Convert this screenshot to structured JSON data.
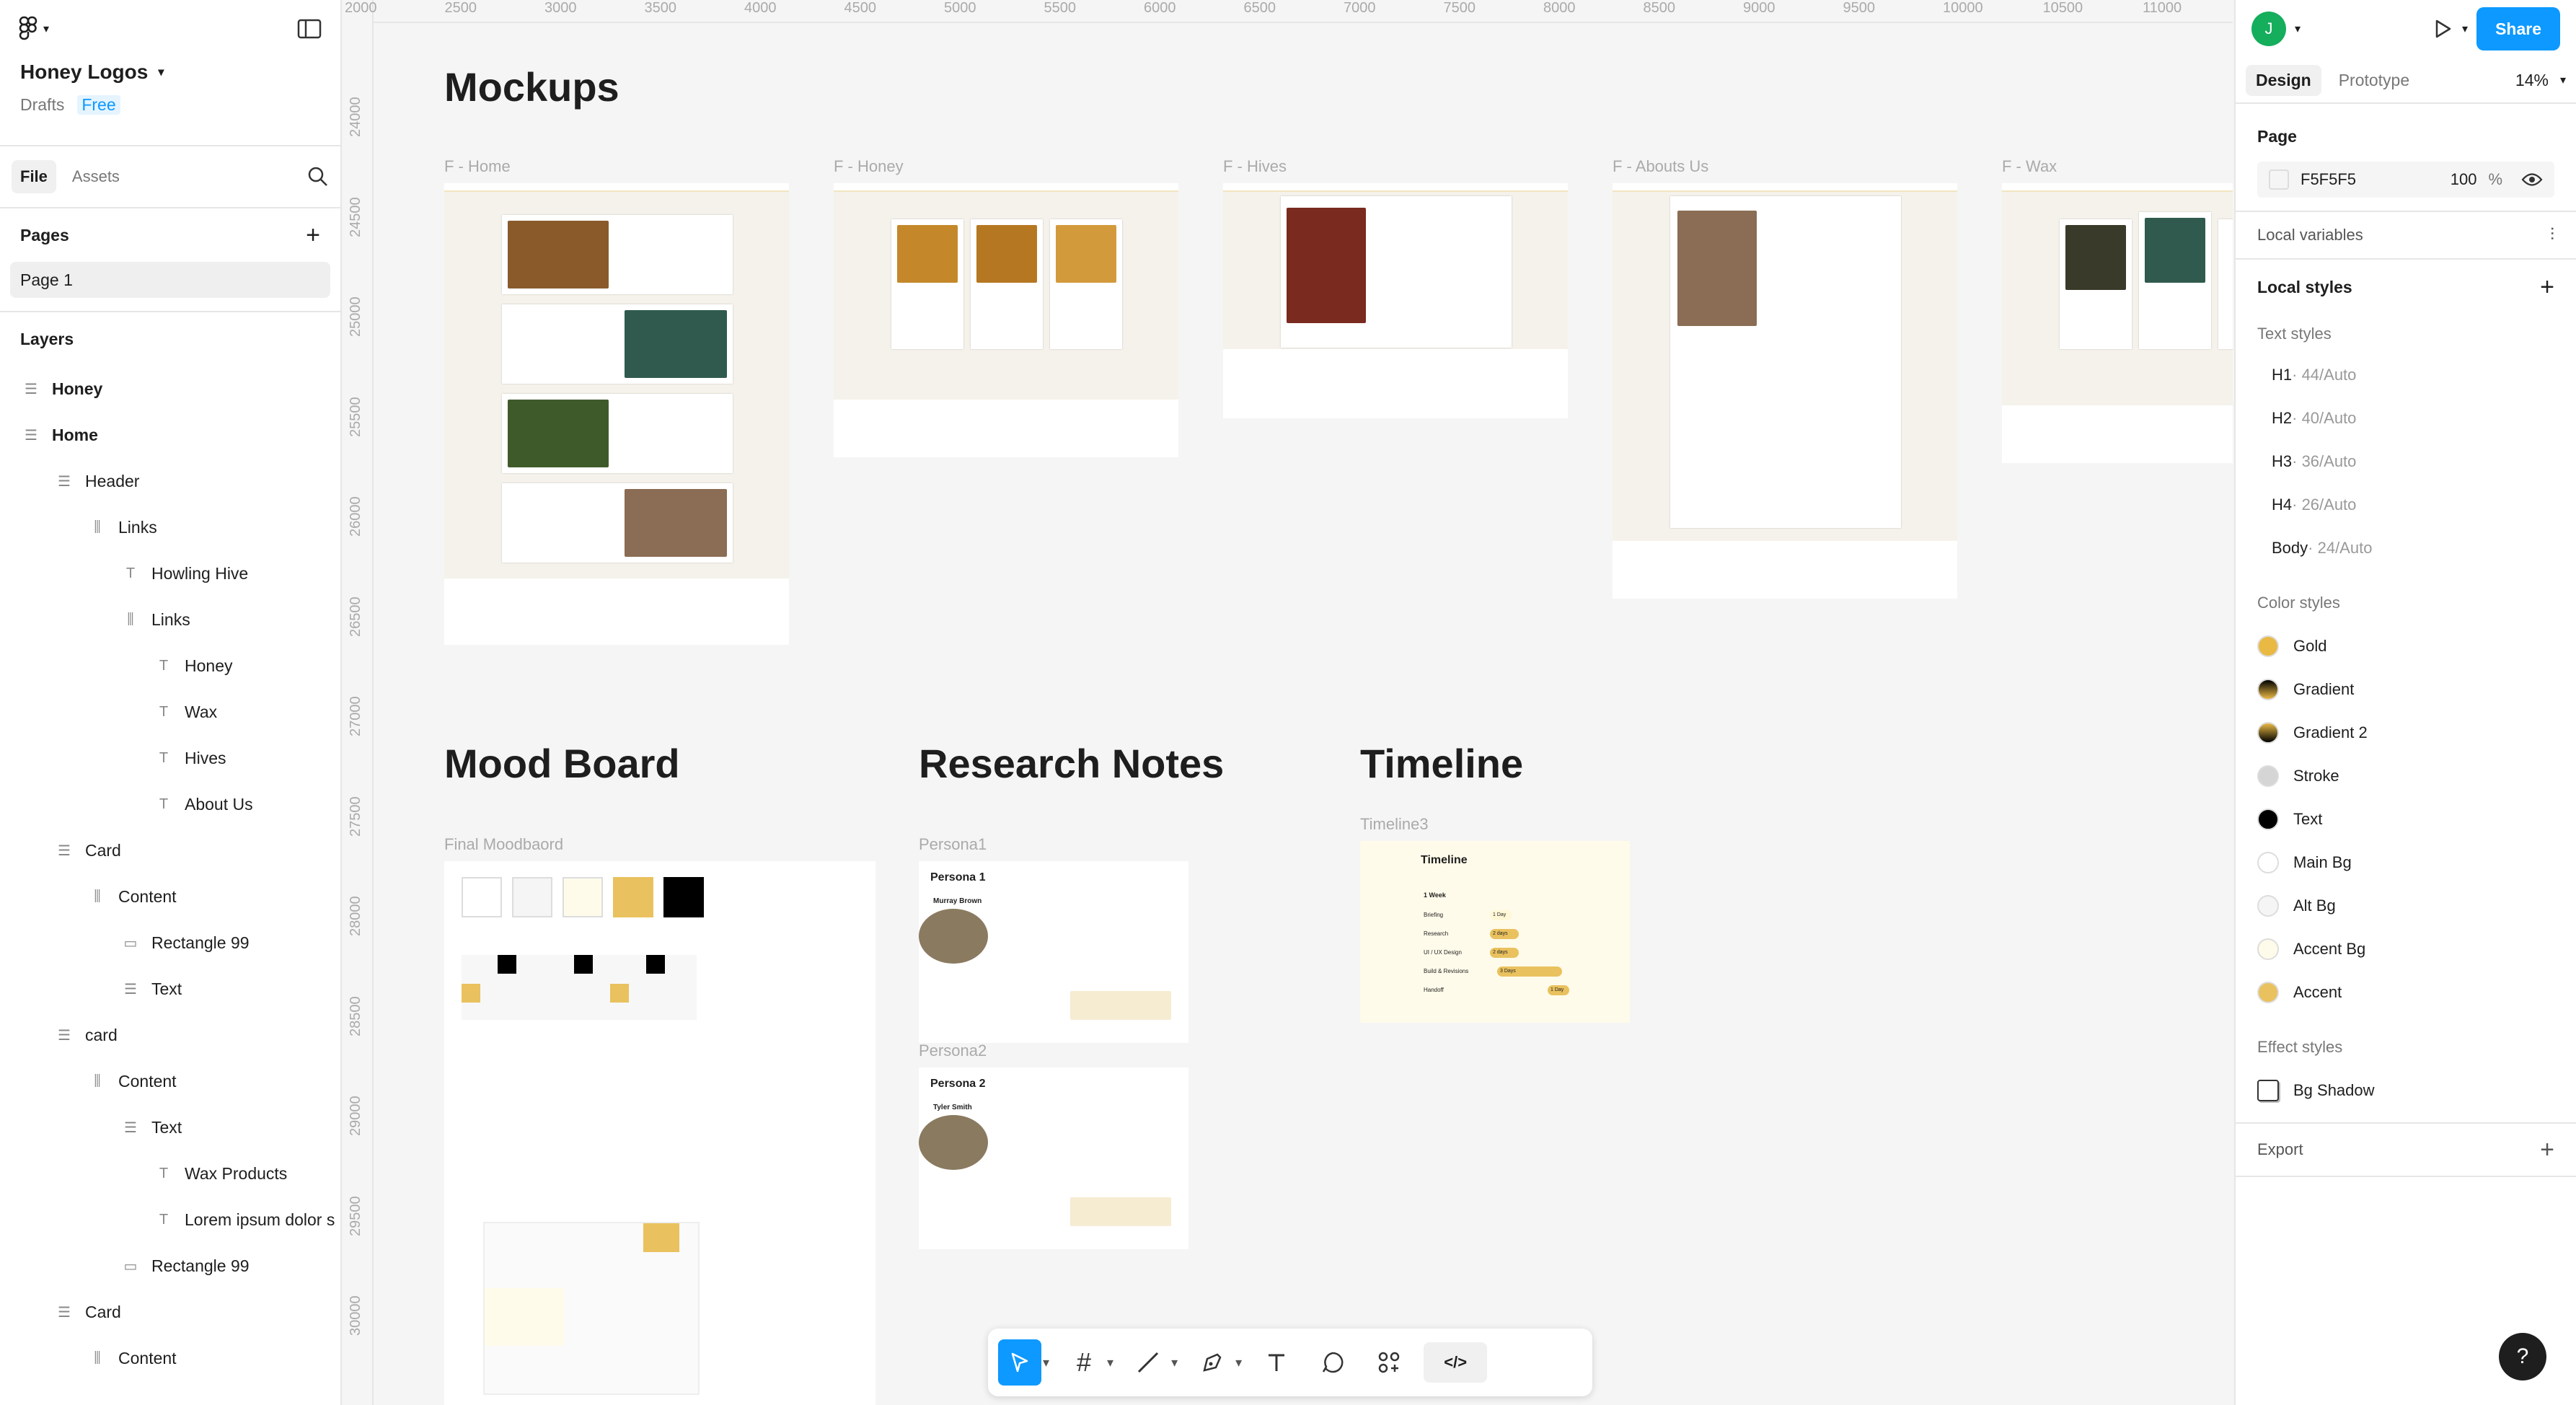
{
  "project": {
    "name": "Honey Logos",
    "location": "Drafts",
    "plan": "Free"
  },
  "left_tabs": [
    "File",
    "Assets"
  ],
  "pages": {
    "heading": "Pages",
    "items": [
      "Page 1"
    ]
  },
  "layers": {
    "heading": "Layers",
    "items": [
      {
        "label": "Honey",
        "icon": "frame",
        "indent": 0
      },
      {
        "label": "Home",
        "icon": "frame",
        "indent": 0
      },
      {
        "label": "Header",
        "icon": "frame",
        "indent": 1
      },
      {
        "label": "Links",
        "icon": "autolayout",
        "indent": 2
      },
      {
        "label": "Howling Hive",
        "icon": "text",
        "indent": 3
      },
      {
        "label": "Links",
        "icon": "autolayout",
        "indent": 3
      },
      {
        "label": "Honey",
        "icon": "text",
        "indent": 4
      },
      {
        "label": "Wax",
        "icon": "text",
        "indent": 4
      },
      {
        "label": "Hives",
        "icon": "text",
        "indent": 4
      },
      {
        "label": "About Us",
        "icon": "text",
        "indent": 4
      },
      {
        "label": "Card",
        "icon": "frame",
        "indent": 1
      },
      {
        "label": "Content",
        "icon": "autolayout",
        "indent": 2
      },
      {
        "label": "Rectangle 99",
        "icon": "rect",
        "indent": 3
      },
      {
        "label": "Text",
        "icon": "frame",
        "indent": 3
      },
      {
        "label": "card",
        "icon": "frame",
        "indent": 1
      },
      {
        "label": "Content",
        "icon": "autolayout",
        "indent": 2
      },
      {
        "label": "Text",
        "icon": "frame",
        "indent": 3
      },
      {
        "label": "Wax Products",
        "icon": "text",
        "indent": 4
      },
      {
        "label": "Lorem ipsum dolor s",
        "icon": "text",
        "indent": 4
      },
      {
        "label": "Rectangle 99",
        "icon": "rect",
        "indent": 3
      },
      {
        "label": "Card",
        "icon": "frame",
        "indent": 1
      },
      {
        "label": "Content",
        "icon": "autolayout",
        "indent": 2
      }
    ]
  },
  "ruler": {
    "x_ticks": [
      "2000",
      "2500",
      "3000",
      "3500",
      "4000",
      "4500",
      "5000",
      "5500",
      "6000",
      "6500",
      "7000",
      "7500",
      "8000",
      "8500",
      "9000",
      "9500",
      "10000",
      "10500",
      "11000"
    ],
    "y_ticks": [
      "24000",
      "24500",
      "25000",
      "25500",
      "26000",
      "26500",
      "27000",
      "27500",
      "28000",
      "28500",
      "29000",
      "29500",
      "30000"
    ]
  },
  "canvas": {
    "mockups_title": "Mockups",
    "frames": [
      "F - Home",
      "F - Honey",
      "F - Hives",
      "F - Abouts Us",
      "F - Wax"
    ],
    "mood_title": "Mood Board",
    "mood_frame": "Final Moodbaord",
    "research_title": "Research Notes",
    "persona1_label": "Persona1",
    "persona2_label": "Persona2",
    "persona1": {
      "title": "Persona 1",
      "name": "Murray Brown"
    },
    "persona2": {
      "title": "Persona 2",
      "name": "Tyler Smith"
    },
    "timeline_title": "Timeline",
    "timeline_frame": "Timeline3",
    "timeline": {
      "heading": "Timeline",
      "week": "1 Week",
      "rows": [
        {
          "task": "Briefing",
          "dur": "1 Day"
        },
        {
          "task": "Research",
          "dur": "2 days"
        },
        {
          "task": "UI / UX Design",
          "dur": "2 days"
        },
        {
          "task": "Build & Revisions",
          "dur": "3 Days"
        },
        {
          "task": "Handoff",
          "dur": "1 Day"
        }
      ]
    }
  },
  "right": {
    "avatar_initial": "J",
    "share": "Share",
    "tabs": [
      "Design",
      "Prototype"
    ],
    "zoom": "14%",
    "page_heading": "Page",
    "page_color": "F5F5F5",
    "page_opacity": "100",
    "page_opacity_unit": "%",
    "local_variables": "Local variables",
    "local_styles": "Local styles",
    "text_styles_heading": "Text styles",
    "text_styles": [
      {
        "name": "H1",
        "meta": " · 44/Auto"
      },
      {
        "name": "H2",
        "meta": " · 40/Auto"
      },
      {
        "name": "H3",
        "meta": " · 36/Auto"
      },
      {
        "name": "H4",
        "meta": " · 26/Auto"
      },
      {
        "name": "Body",
        "meta": " · 24/Auto"
      }
    ],
    "color_styles_heading": "Color styles",
    "color_styles": [
      {
        "name": "Gold",
        "color": "#e9b944"
      },
      {
        "name": "Gradient",
        "color": "linear-gradient(#000,#e9b944)"
      },
      {
        "name": "Gradient 2",
        "color": "linear-gradient(#e9b944,#000)"
      },
      {
        "name": "Stroke",
        "color": "#d5d5d5"
      },
      {
        "name": "Text",
        "color": "#000000"
      },
      {
        "name": "Main Bg",
        "color": "#ffffff"
      },
      {
        "name": "Alt Bg",
        "color": "#f5f5f5"
      },
      {
        "name": "Accent Bg",
        "color": "#fffbea"
      },
      {
        "name": "Accent",
        "color": "#e9c15e"
      }
    ],
    "effect_styles_heading": "Effect styles",
    "effect_styles": [
      "Bg Shadow"
    ],
    "export": "Export"
  },
  "help": "?"
}
